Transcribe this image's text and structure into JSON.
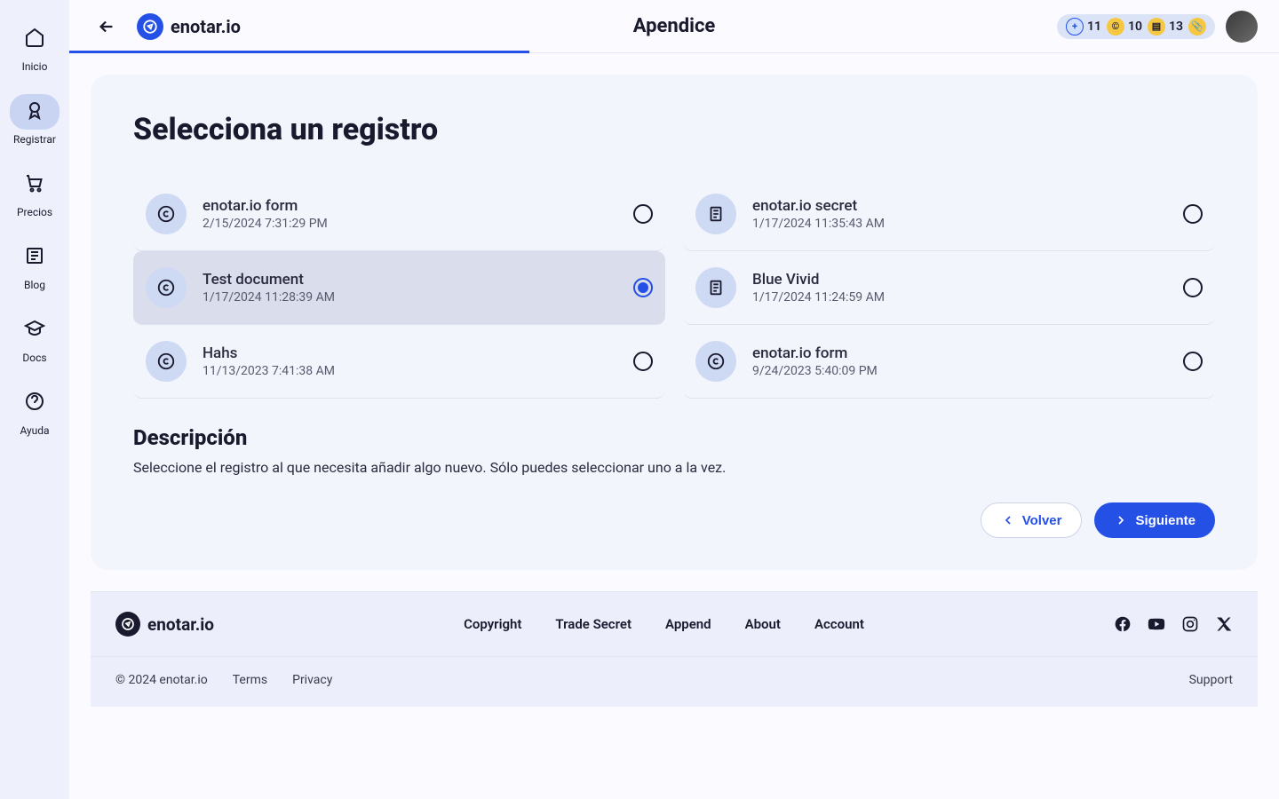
{
  "sidenav": {
    "items": [
      {
        "label": "Inicio"
      },
      {
        "label": "Registrar"
      },
      {
        "label": "Precios"
      },
      {
        "label": "Blog"
      },
      {
        "label": "Docs"
      },
      {
        "label": "Ayuda"
      }
    ]
  },
  "header": {
    "brand": "enotar.io",
    "page_title": "Apendice",
    "counters": {
      "a": "11",
      "b": "10",
      "c": "13"
    }
  },
  "card": {
    "heading": "Selecciona un registro",
    "records": [
      {
        "title": "enotar.io form",
        "date": "2/15/2024 7:31:29 PM",
        "icon": "copyright",
        "selected": false
      },
      {
        "title": "enotar.io secret",
        "date": "1/17/2024 11:35:43 AM",
        "icon": "doc",
        "selected": false
      },
      {
        "title": "Test document",
        "date": "1/17/2024 11:28:39 AM",
        "icon": "copyright",
        "selected": true
      },
      {
        "title": "Blue Vivid",
        "date": "1/17/2024 11:24:59 AM",
        "icon": "doc",
        "selected": false
      },
      {
        "title": "Hahs",
        "date": "11/13/2023 7:41:38 AM",
        "icon": "copyright",
        "selected": false
      },
      {
        "title": "enotar.io form",
        "date": "9/24/2023 5:40:09 PM",
        "icon": "copyright",
        "selected": false
      }
    ],
    "desc_heading": "Descripción",
    "desc_text": "Seleccione el registro al que necesita añadir algo nuevo. Sólo puedes seleccionar uno a la vez.",
    "back_btn": "Volver",
    "next_btn": "Siguiente"
  },
  "footer": {
    "brand": "enotar.io",
    "links": [
      "Copyright",
      "Trade Secret",
      "Append",
      "About",
      "Account"
    ],
    "copyright": "© 2024 enotar.io",
    "terms": "Terms",
    "privacy": "Privacy",
    "support": "Support"
  }
}
